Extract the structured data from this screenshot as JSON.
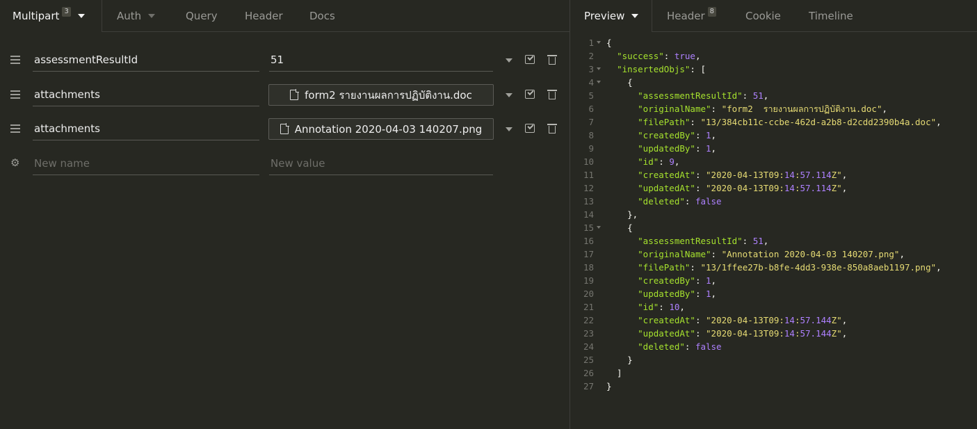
{
  "request": {
    "tabs": [
      {
        "label": "Multipart",
        "badge": "3"
      },
      {
        "label": "Auth"
      },
      {
        "label": "Query"
      },
      {
        "label": "Header"
      },
      {
        "label": "Docs"
      }
    ],
    "params": [
      {
        "name": "assessmentResultId",
        "value": "51",
        "type": "text"
      },
      {
        "name": "attachments",
        "file": "form2 รายงานผลการปฏิบัติงาน.doc",
        "type": "file"
      },
      {
        "name": "attachments",
        "file": "Annotation 2020-04-03 140207.png",
        "type": "file"
      }
    ],
    "new_row": {
      "name_placeholder": "New name",
      "value_placeholder": "New value"
    }
  },
  "response": {
    "tabs": [
      {
        "label": "Preview"
      },
      {
        "label": "Header",
        "badge": "8"
      },
      {
        "label": "Cookie"
      },
      {
        "label": "Timeline"
      }
    ],
    "lines": [
      {
        "n": "1",
        "text": "{"
      },
      {
        "n": "2",
        "text": "  \"success\": true,"
      },
      {
        "n": "3",
        "text": "  \"insertedObjs\": ["
      },
      {
        "n": "4",
        "text": "    {"
      },
      {
        "n": "5",
        "text": "      \"assessmentResultId\": 51,"
      },
      {
        "n": "6",
        "text": "      \"originalName\": \"form2  รายงานผลการปฏิบัติงาน.doc\","
      },
      {
        "n": "7",
        "text": "      \"filePath\": \"13/384cb11c-ccbe-462d-a2b8-d2cdd2390b4a.doc\","
      },
      {
        "n": "8",
        "text": "      \"createdBy\": 1,"
      },
      {
        "n": "9",
        "text": "      \"updatedBy\": 1,"
      },
      {
        "n": "10",
        "text": "      \"id\": 9,"
      },
      {
        "n": "11",
        "text": "      \"createdAt\": \"2020-04-13T09:14:57.114Z\","
      },
      {
        "n": "12",
        "text": "      \"updatedAt\": \"2020-04-13T09:14:57.114Z\","
      },
      {
        "n": "13",
        "text": "      \"deleted\": false"
      },
      {
        "n": "14",
        "text": "    },"
      },
      {
        "n": "15",
        "text": "    {"
      },
      {
        "n": "16",
        "text": "      \"assessmentResultId\": 51,"
      },
      {
        "n": "17",
        "text": "      \"originalName\": \"Annotation 2020-04-03 140207.png\","
      },
      {
        "n": "18",
        "text": "      \"filePath\": \"13/1ffee27b-b8fe-4dd3-938e-850a8aeb1197.png\","
      },
      {
        "n": "19",
        "text": "      \"createdBy\": 1,"
      },
      {
        "n": "20",
        "text": "      \"updatedBy\": 1,"
      },
      {
        "n": "21",
        "text": "      \"id\": 10,"
      },
      {
        "n": "22",
        "text": "      \"createdAt\": \"2020-04-13T09:14:57.144Z\","
      },
      {
        "n": "23",
        "text": "      \"updatedAt\": \"2020-04-13T09:14:57.144Z\","
      },
      {
        "n": "24",
        "text": "      \"deleted\": false"
      },
      {
        "n": "25",
        "text": "    }"
      },
      {
        "n": "26",
        "text": "  ]"
      },
      {
        "n": "27",
        "text": "}"
      }
    ],
    "foldable_lines": [
      "1",
      "3",
      "4",
      "15"
    ]
  }
}
